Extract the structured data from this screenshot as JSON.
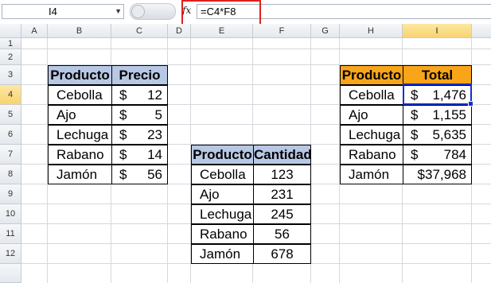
{
  "formula_bar": {
    "name_box": "I4",
    "fx_label": "fx",
    "formula": "=C4*F8"
  },
  "columns": [
    "A",
    "B",
    "C",
    "D",
    "E",
    "F",
    "G",
    "H",
    "I"
  ],
  "rows": [
    "1",
    "2",
    "3",
    "4",
    "5",
    "6",
    "7",
    "8",
    "9",
    "10",
    "11",
    "12"
  ],
  "price_table": {
    "headers": [
      "Producto",
      "Precio"
    ],
    "rows": [
      {
        "producto": "Cebolla",
        "sym": "$",
        "precio": "12"
      },
      {
        "producto": "Ajo",
        "sym": "$",
        "precio": "5"
      },
      {
        "producto": "Lechuga",
        "sym": "$",
        "precio": "23"
      },
      {
        "producto": "Rabano",
        "sym": "$",
        "precio": "14"
      },
      {
        "producto": "Jamón",
        "sym": "$",
        "precio": "56"
      }
    ]
  },
  "quantity_table": {
    "headers": [
      "Producto",
      "Cantidad"
    ],
    "rows": [
      {
        "producto": "Cebolla",
        "cantidad": "123"
      },
      {
        "producto": "Ajo",
        "cantidad": "231"
      },
      {
        "producto": "Lechuga",
        "cantidad": "245"
      },
      {
        "producto": "Rabano",
        "cantidad": "56"
      },
      {
        "producto": "Jamón",
        "cantidad": "678"
      }
    ]
  },
  "total_table": {
    "headers": [
      "Producto",
      "Total"
    ],
    "rows": [
      {
        "producto": "Cebolla",
        "sym": "$",
        "total": "1,476"
      },
      {
        "producto": "Ajo",
        "sym": "$",
        "total": "1,155"
      },
      {
        "producto": "Lechuga",
        "sym": "$",
        "total": "5,635"
      },
      {
        "producto": "Rabano",
        "sym": "$",
        "total": "784"
      },
      {
        "producto": "Jamón",
        "sym": "",
        "total": "$37,968"
      }
    ]
  },
  "colors": {
    "blue_header": "#b8c8e4",
    "orange_header": "#f8a51a",
    "selection": "#1530c8",
    "highlight_box": "#e02020"
  }
}
